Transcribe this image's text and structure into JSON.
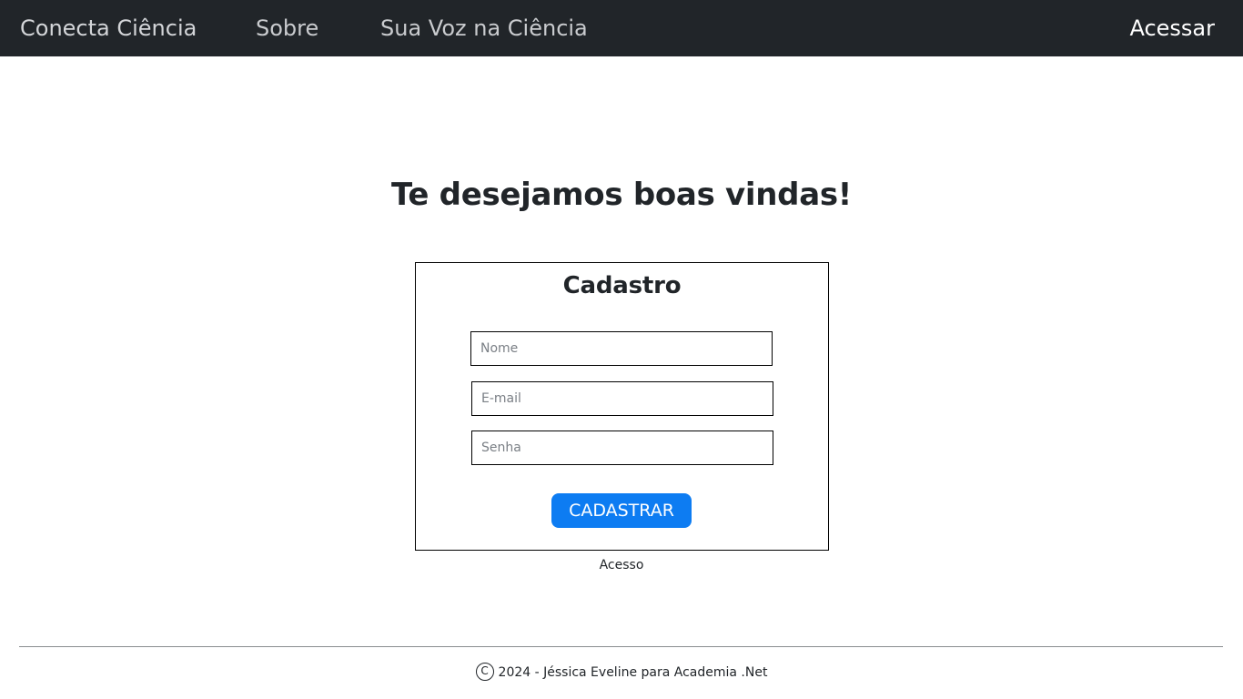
{
  "nav": {
    "brand": "Conecta Ciência",
    "links": [
      "Sobre",
      "Sua Voz na Ciência"
    ],
    "login": "Acessar"
  },
  "main": {
    "welcome": "Te desejamos boas vindas!",
    "form": {
      "title": "Cadastro",
      "name_placeholder": "Nome",
      "email_placeholder": "E-mail",
      "password_placeholder": "Senha",
      "submit_label": "CADASTRAR"
    },
    "access_link": "Acesso"
  },
  "footer": {
    "copyright_icon": "copyright-icon",
    "text": "2024 - Jéssica Eveline para Academia .Net"
  },
  "colors": {
    "navbar": "#212529",
    "primary_button": "#0d7cf2",
    "text": "#212529"
  }
}
